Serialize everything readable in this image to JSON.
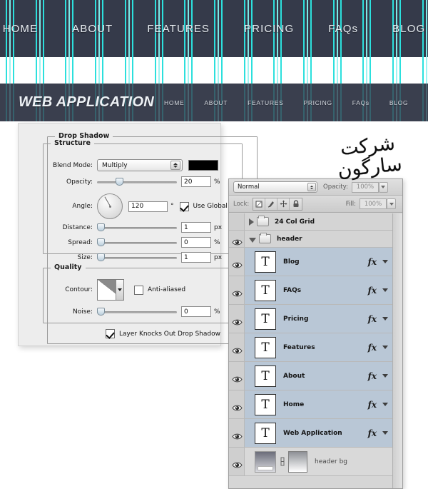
{
  "mockup": {
    "top_nav": {
      "items": [
        "HOME",
        "ABOUT",
        "FEATURES",
        "PRICING",
        "FAQs",
        "BLOG"
      ],
      "bg_color": "#353a4a",
      "text_color": "#e9eef3",
      "grid_color": "#2ce0dd"
    },
    "app_bar": {
      "brand": "WEB APPLICATION",
      "bg_color": "#3a3f4e",
      "nav_items": [
        "HOME",
        "ABOUT",
        "FEATURES",
        "PRICING",
        "FAQs",
        "BLOG"
      ]
    }
  },
  "layer_style_dialog": {
    "effect_title": "Drop Shadow",
    "structure": {
      "legend": "Structure",
      "blend_mode_label": "Blend Mode:",
      "blend_mode_value": "Multiply",
      "shadow_color": "#000000",
      "opacity_label": "Opacity:",
      "opacity_value": "20",
      "opacity_unit": "%",
      "angle_label": "Angle:",
      "angle_value": "120",
      "angle_unit": "°",
      "use_global_light_label": "Use Global Light",
      "use_global_light_checked": true,
      "distance_label": "Distance:",
      "distance_value": "1",
      "distance_unit": "px",
      "spread_label": "Spread:",
      "spread_value": "0",
      "spread_unit": "%",
      "size_label": "Size:",
      "size_value": "1",
      "size_unit": "px"
    },
    "quality": {
      "legend": "Quality",
      "contour_label": "Contour:",
      "anti_aliased_label": "Anti-aliased",
      "anti_aliased_checked": false,
      "noise_label": "Noise:",
      "noise_value": "0",
      "noise_unit": "%",
      "knocks_out_label": "Layer Knocks Out Drop Shadow",
      "knocks_out_checked": true
    }
  },
  "layers_panel": {
    "blend_mode": "Normal",
    "opacity_label": "Opacity:",
    "opacity_value": "100%",
    "lock_label": "Lock:",
    "lock_icons": [
      "lock-transparent-pixels-icon",
      "lock-image-pixels-icon",
      "lock-position-icon",
      "lock-all-icon"
    ],
    "fill_label": "Fill:",
    "fill_value": "100%",
    "layers": [
      {
        "name": "24 Col Grid",
        "type": "group",
        "visible": false,
        "expanded": false,
        "has_fx": false,
        "selected": false
      },
      {
        "name": "header",
        "type": "group",
        "visible": true,
        "expanded": true,
        "has_fx": false,
        "selected": false
      },
      {
        "name": "Blog",
        "type": "text",
        "visible": true,
        "has_fx": true,
        "selected": true
      },
      {
        "name": "FAQs",
        "type": "text",
        "visible": true,
        "has_fx": true,
        "selected": true
      },
      {
        "name": "Pricing",
        "type": "text",
        "visible": true,
        "has_fx": true,
        "selected": true
      },
      {
        "name": "Features",
        "type": "text",
        "visible": true,
        "has_fx": true,
        "selected": true
      },
      {
        "name": "About",
        "type": "text",
        "visible": true,
        "has_fx": true,
        "selected": true
      },
      {
        "name": "Home",
        "type": "text",
        "visible": true,
        "has_fx": true,
        "selected": true
      },
      {
        "name": "Web Application",
        "type": "text",
        "visible": true,
        "has_fx": true,
        "selected": true
      },
      {
        "name": "header bg",
        "type": "gradient-mask",
        "visible": true,
        "has_fx": false,
        "selected": false
      }
    ]
  },
  "watermark": {
    "text": "شرکت سارگون"
  }
}
